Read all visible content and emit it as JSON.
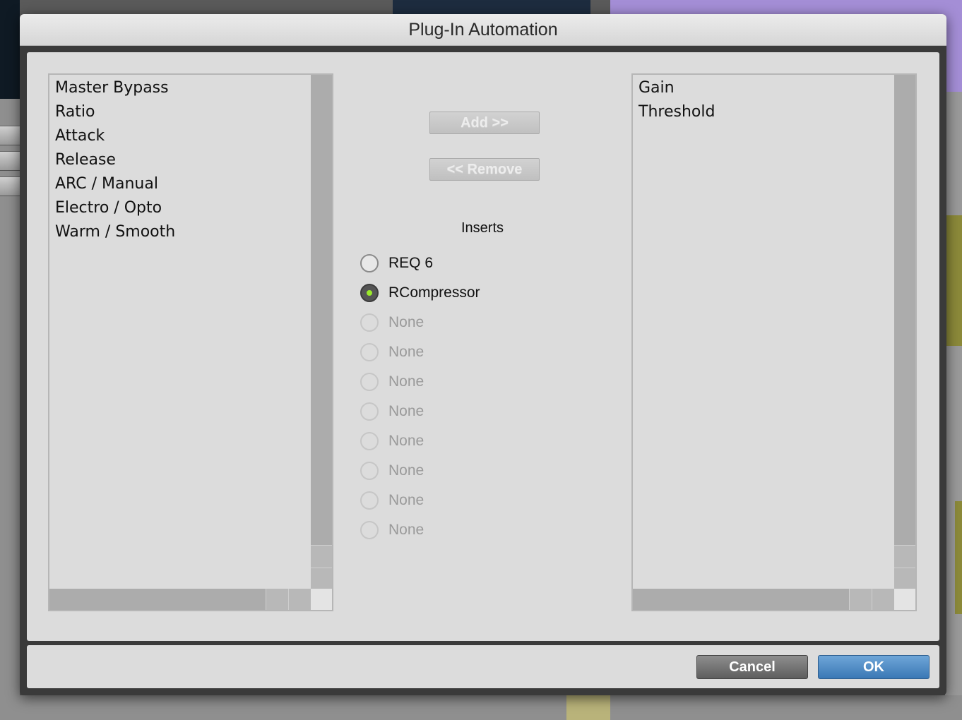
{
  "dialog": {
    "title": "Plug-In Automation"
  },
  "available_params": {
    "items": [
      "Master Bypass",
      "Ratio",
      "Attack",
      "Release",
      "ARC / Manual",
      "Electro / Opto",
      "Warm / Smooth"
    ]
  },
  "automated_params": {
    "items": [
      "Gain",
      "Threshold"
    ]
  },
  "actions": {
    "add_label": "Add >>",
    "remove_label": "<< Remove"
  },
  "inserts": {
    "heading": "Inserts",
    "items": [
      {
        "label": "REQ 6",
        "selected": false,
        "enabled": true
      },
      {
        "label": "RCompressor",
        "selected": true,
        "enabled": true
      },
      {
        "label": "None",
        "selected": false,
        "enabled": false
      },
      {
        "label": "None",
        "selected": false,
        "enabled": false
      },
      {
        "label": "None",
        "selected": false,
        "enabled": false
      },
      {
        "label": "None",
        "selected": false,
        "enabled": false
      },
      {
        "label": "None",
        "selected": false,
        "enabled": false
      },
      {
        "label": "None",
        "selected": false,
        "enabled": false
      },
      {
        "label": "None",
        "selected": false,
        "enabled": false
      },
      {
        "label": "None",
        "selected": false,
        "enabled": false
      }
    ]
  },
  "footer": {
    "cancel_label": "Cancel",
    "ok_label": "OK"
  },
  "colors": {
    "ok_button": "#3b78b5",
    "radio_selected_dot": "#9bea2a"
  }
}
